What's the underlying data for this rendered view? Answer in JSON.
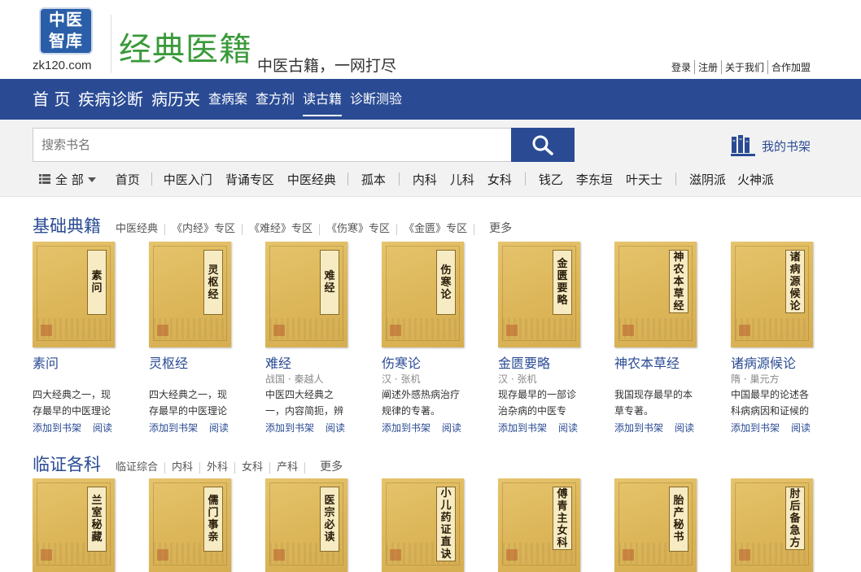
{
  "header": {
    "logo_line1": "中医",
    "logo_line2": "智库",
    "logo_url": "zk120.com",
    "title": "经典医籍",
    "slogan": "中医古籍，一网打尽",
    "links": [
      "登录",
      "注册",
      "关于我们",
      "合作加盟"
    ]
  },
  "nav": {
    "items": [
      "首 页",
      "疾病诊断",
      "病历夹",
      "查病案",
      "查方剂",
      "读古籍",
      "诊断测验"
    ],
    "active": "读古籍"
  },
  "search": {
    "placeholder": "搜索书名",
    "icon": "search-icon",
    "shelf_label": "我的书架",
    "shelf_icon": "bookshelf-icon"
  },
  "categories": {
    "all_label": "全 部",
    "items": [
      "首页",
      "中医入门",
      "背诵专区",
      "中医经典",
      "孤本",
      "内科",
      "儿科",
      "女科",
      "钱乙",
      "李东垣",
      "叶天士",
      "滋阴派",
      "火神派"
    ]
  },
  "sections": [
    {
      "title": "基础典籍",
      "tabs": [
        "中医经典",
        "《内经》专区",
        "《难经》专区",
        "《伤寒》专区",
        "《金匮》专区",
        "更多"
      ],
      "books": [
        {
          "cover": "素问",
          "title": "素问",
          "author": "",
          "desc": "四大经典之一，现存最早的中医理论",
          "add": "添加到书架",
          "read": "阅读"
        },
        {
          "cover": "灵枢经",
          "title": "灵枢经",
          "author": "",
          "desc": "四大经典之一，现存最早的中医理论",
          "add": "添加到书架",
          "read": "阅读"
        },
        {
          "cover": "难经",
          "title": "难经",
          "author": "战国 · 秦越人",
          "desc": "中医四大经典之一，内容简扼，辨",
          "add": "添加到书架",
          "read": "阅读"
        },
        {
          "cover": "伤寒论",
          "title": "伤寒论",
          "author": "汉 · 张机",
          "desc": "阐述外感热病治疗规律的专著。",
          "add": "添加到书架",
          "read": "阅读"
        },
        {
          "cover": "金匮要略",
          "title": "金匮要略",
          "author": "汉 · 张机",
          "desc": "现存最早的一部诊治杂病的中医专",
          "add": "添加到书架",
          "read": "阅读"
        },
        {
          "cover": "神农本草经",
          "title": "神农本草经",
          "author": "",
          "desc": "我国现存最早的本草专著。",
          "add": "添加到书架",
          "read": "阅读"
        },
        {
          "cover": "诸病源候论",
          "title": "诸病源候论",
          "author": "隋 · 巢元方",
          "desc": "中国最早的论述各科病病因和证候的",
          "add": "添加到书架",
          "read": "阅读"
        }
      ]
    },
    {
      "title": "临证各科",
      "tabs": [
        "临证综合",
        "内科",
        "外科",
        "女科",
        "产科",
        "更多"
      ],
      "books": [
        {
          "cover": "兰室秘藏"
        },
        {
          "cover": "儒门事亲"
        },
        {
          "cover": "医宗必读"
        },
        {
          "cover": "小儿药证直诀"
        },
        {
          "cover": "傅青主女科"
        },
        {
          "cover": "胎产秘书"
        },
        {
          "cover": "肘后备急方"
        }
      ]
    }
  ],
  "colors": {
    "brand_blue": "#2a4b94",
    "title_green": "#3a9a3a",
    "cover_gold": "#dcb659"
  }
}
